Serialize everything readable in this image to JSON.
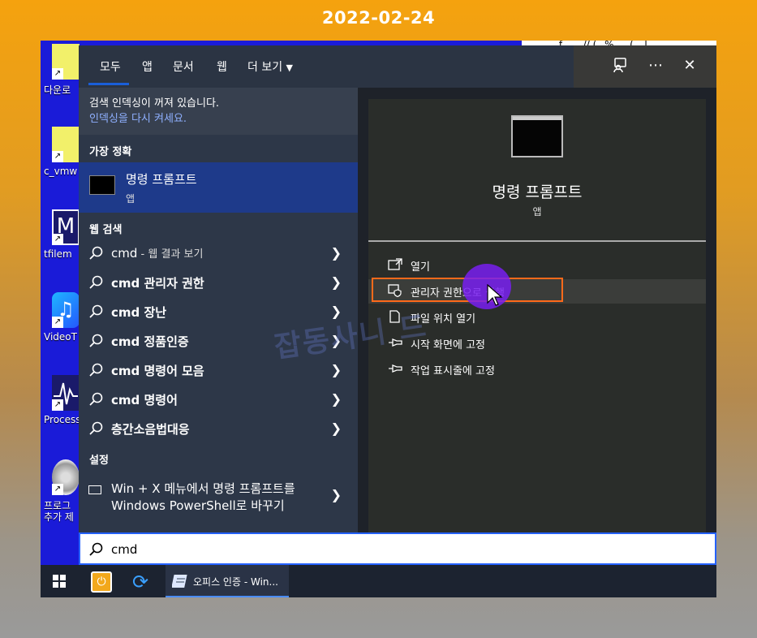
{
  "banner": {
    "date": "2022-02-24"
  },
  "desktop": {
    "icons": [
      {
        "label": "다운로",
        "icon": "folder-icon"
      },
      {
        "label": "c_vmw",
        "icon": "file-icon"
      },
      {
        "label": "tfilem",
        "icon": "app-icon"
      },
      {
        "label": "VideoT",
        "icon": "music-icon"
      },
      {
        "label": "Process",
        "icon": "pulse-icon"
      },
      {
        "label": "프로그",
        "icon": "cd-icon"
      }
    ],
    "icon_sub_label": "추가 제",
    "scribble": "_______ f ___ // (_ % __ ( _ l _"
  },
  "tabs": {
    "all": "모두",
    "apps": "앱",
    "documents": "문서",
    "web": "웹",
    "more": "더 보기"
  },
  "notice": {
    "line1": "검색 인덱싱이 꺼져 있습니다.",
    "link": "인덱싱을 다시 켜세요."
  },
  "sections": {
    "best_match": "가장 정확",
    "web_search": "웹 검색",
    "settings": "설정"
  },
  "best_match": {
    "title": "명령 프롬프트",
    "type": "앱"
  },
  "web_results": [
    {
      "query": "cmd",
      "suffix": " - 웹 결과 보기",
      "bold": false
    },
    {
      "query": "cmd 관리자 권한",
      "suffix": "",
      "bold": true
    },
    {
      "query": "cmd 장난",
      "suffix": "",
      "bold": true
    },
    {
      "query": "cmd 정품인증",
      "suffix": "",
      "bold": true
    },
    {
      "query": "cmd 명령어 모음",
      "suffix": "",
      "bold": true
    },
    {
      "query": "cmd 명령어",
      "suffix": "",
      "bold": true
    },
    {
      "query": "층간소음법대응",
      "suffix": "",
      "bold": true
    }
  ],
  "setting_result": {
    "line1": "Win + X 메뉴에서 명령 프롬프트를",
    "line2": "Windows PowerShell로 바꾸기"
  },
  "preview": {
    "title": "명령 프롬프트",
    "type": "앱",
    "actions": [
      {
        "label": "열기",
        "icon": "open-icon"
      },
      {
        "label": "관리자 권한으로 실행",
        "icon": "shield-icon"
      },
      {
        "label": "파일 위치 열기",
        "icon": "file-location-icon"
      },
      {
        "label": "시작 화면에 고정",
        "icon": "pin-icon"
      },
      {
        "label": "작업 표시줄에 고정",
        "icon": "pin-icon"
      }
    ],
    "watermark": "잡동사니 드"
  },
  "search": {
    "value": "cmd"
  },
  "taskbar": {
    "task_label": "오피스 인증 - Win..."
  },
  "colors": {
    "accent": "#1a5ed8",
    "highlight_box": "#ff6a1a",
    "cursor_blob": "#781ef0"
  }
}
